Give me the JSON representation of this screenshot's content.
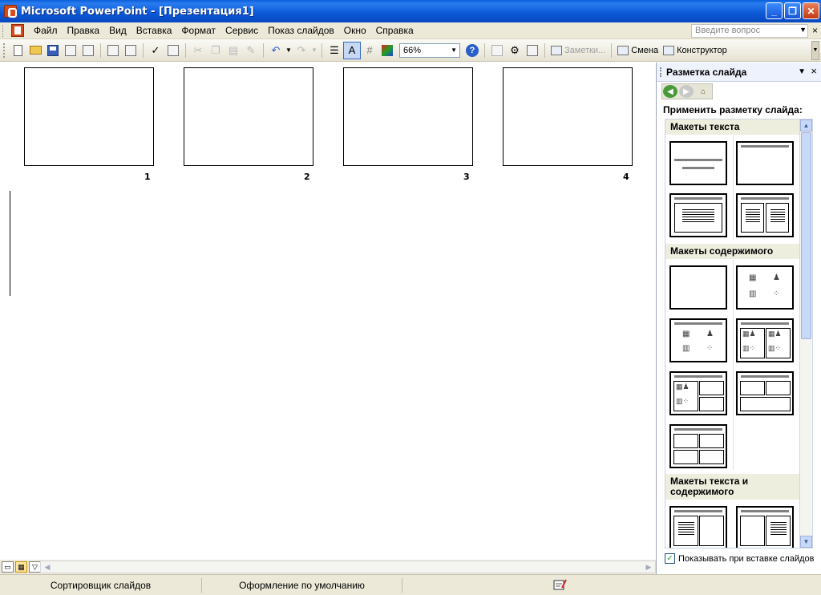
{
  "window": {
    "title": "Microsoft PowerPoint - [Презентация1]",
    "minimize": "_",
    "restore": "❐",
    "close": "✕"
  },
  "menu": {
    "items": [
      "Файл",
      "Правка",
      "Вид",
      "Вставка",
      "Формат",
      "Сервис",
      "Показ слайдов",
      "Окно",
      "Справка"
    ],
    "ask_placeholder": "Введите вопрос",
    "close": "×"
  },
  "toolbar": {
    "zoom": "66%",
    "notes_label": "Заметки...",
    "change_label": "Смена",
    "designer_label": "Конструктор",
    "help": "?"
  },
  "slides": [
    {
      "number": "1"
    },
    {
      "number": "2"
    },
    {
      "number": "3"
    },
    {
      "number": "4"
    }
  ],
  "taskpane": {
    "title": "Разметка слайда",
    "apply_label": "Применить разметку слайда:",
    "categories": [
      "Макеты текста",
      "Макеты содержимого",
      "Макеты текста и содержимого"
    ],
    "show_on_insert": "Показывать при вставке слайдов",
    "show_on_insert_checked": true
  },
  "status": {
    "view_name": "Сортировщик слайдов",
    "design": "Оформление по умолчанию"
  },
  "colors": {
    "titlebar": "#0b58d6",
    "chrome": "#ece9d8",
    "accent": "#316ac5"
  }
}
